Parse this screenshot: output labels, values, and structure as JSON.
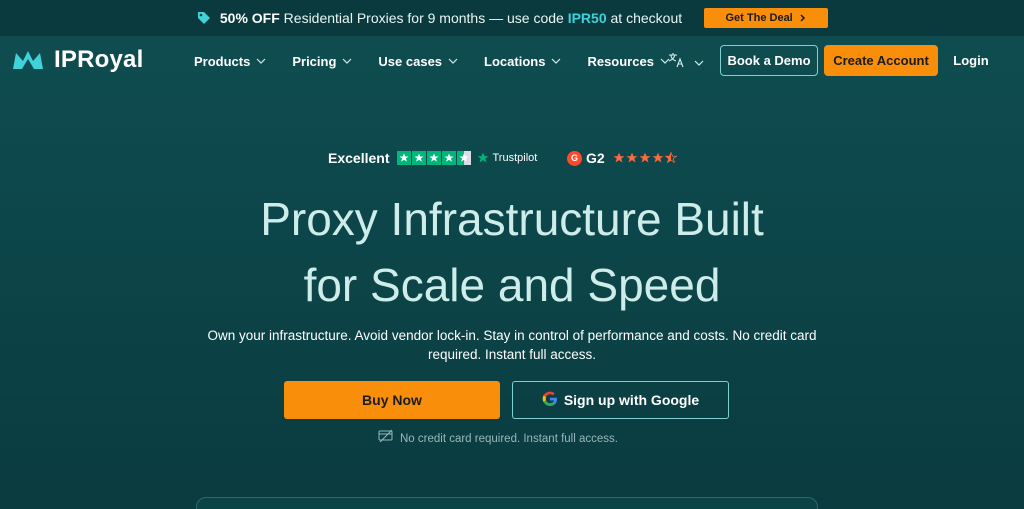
{
  "promo": {
    "lead": "50% OFF",
    "text": "Residential Proxies for 9 months — use code",
    "code": "IPR50",
    "tail": "at checkout",
    "button_label": "Get The Deal"
  },
  "nav": {
    "logo_text": "IPRoyal",
    "items": [
      {
        "label": "Products"
      },
      {
        "label": "Pricing"
      },
      {
        "label": "Use cases"
      },
      {
        "label": "Locations"
      },
      {
        "label": "Resources"
      }
    ],
    "book_demo": "Book a Demo",
    "create_account": "Create Account",
    "login": "Login"
  },
  "ratings": {
    "excellent": "Excellent",
    "trustpilot": "Trustpilot",
    "trustpilot_stars": 4.5,
    "g2_badge": "G",
    "g2_label": "G2",
    "g2_stars": 4.5
  },
  "hero": {
    "title_line1": "Proxy Infrastructure Built",
    "title_line2": "for Scale and Speed",
    "subtitle_line1": "Own your infrastructure. Avoid vendor lock-in. Stay in control of performance and costs. No credit card",
    "subtitle_line2": "required. Instant full access.",
    "buy_now": "Buy Now",
    "google_signup": "Sign up with Google",
    "no_cc_note": "No credit card required. Instant full access."
  },
  "icons": {
    "promo": "tag-icon",
    "logo": "crown-icon",
    "chevron": "chevron-down-icon",
    "language": "translate-icon",
    "google": "google-icon",
    "no_card": "no-credit-card-icon"
  },
  "colors": {
    "accent_orange": "#f98e0b",
    "teal_bg": "#0f4e52",
    "promo_code": "#3fd2d8",
    "trustpilot_green": "#00b67a",
    "g2_red": "#ff492c"
  }
}
